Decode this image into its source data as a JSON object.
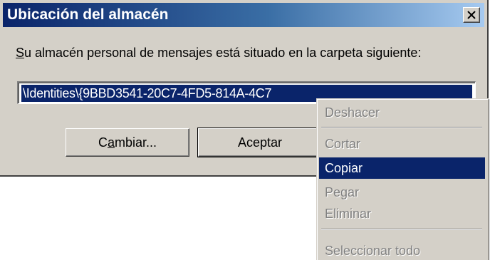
{
  "dialog": {
    "title": "Ubicación del almacén",
    "label_mnemonic": "S",
    "label_rest": "u almacén personal de mensajes está situado en la carpeta siguiente:",
    "path_value": "\\Identities\\{9BBD3541-20C7-4FD5-814A-4C7",
    "buttons": {
      "change_mnemonic_pre": "C",
      "change_mnemonic": "a",
      "change_rest": "mbiar...",
      "accept_label": "Aceptar"
    }
  },
  "context_menu": {
    "items": [
      {
        "label": "Deshacer",
        "enabled": false
      },
      {
        "label": "Cortar",
        "enabled": false
      },
      {
        "label": "Copiar",
        "enabled": true,
        "selected": true
      },
      {
        "label": "Pegar",
        "enabled": false
      },
      {
        "label": "Eliminar",
        "enabled": false
      },
      {
        "label": "Seleccionar todo",
        "enabled": false
      }
    ]
  },
  "colors": {
    "title_gradient_start": "#0a246a",
    "title_gradient_end": "#a6caf0",
    "window_face": "#d4d0c8",
    "selection": "#0a246a",
    "disabled_text": "#808080"
  }
}
